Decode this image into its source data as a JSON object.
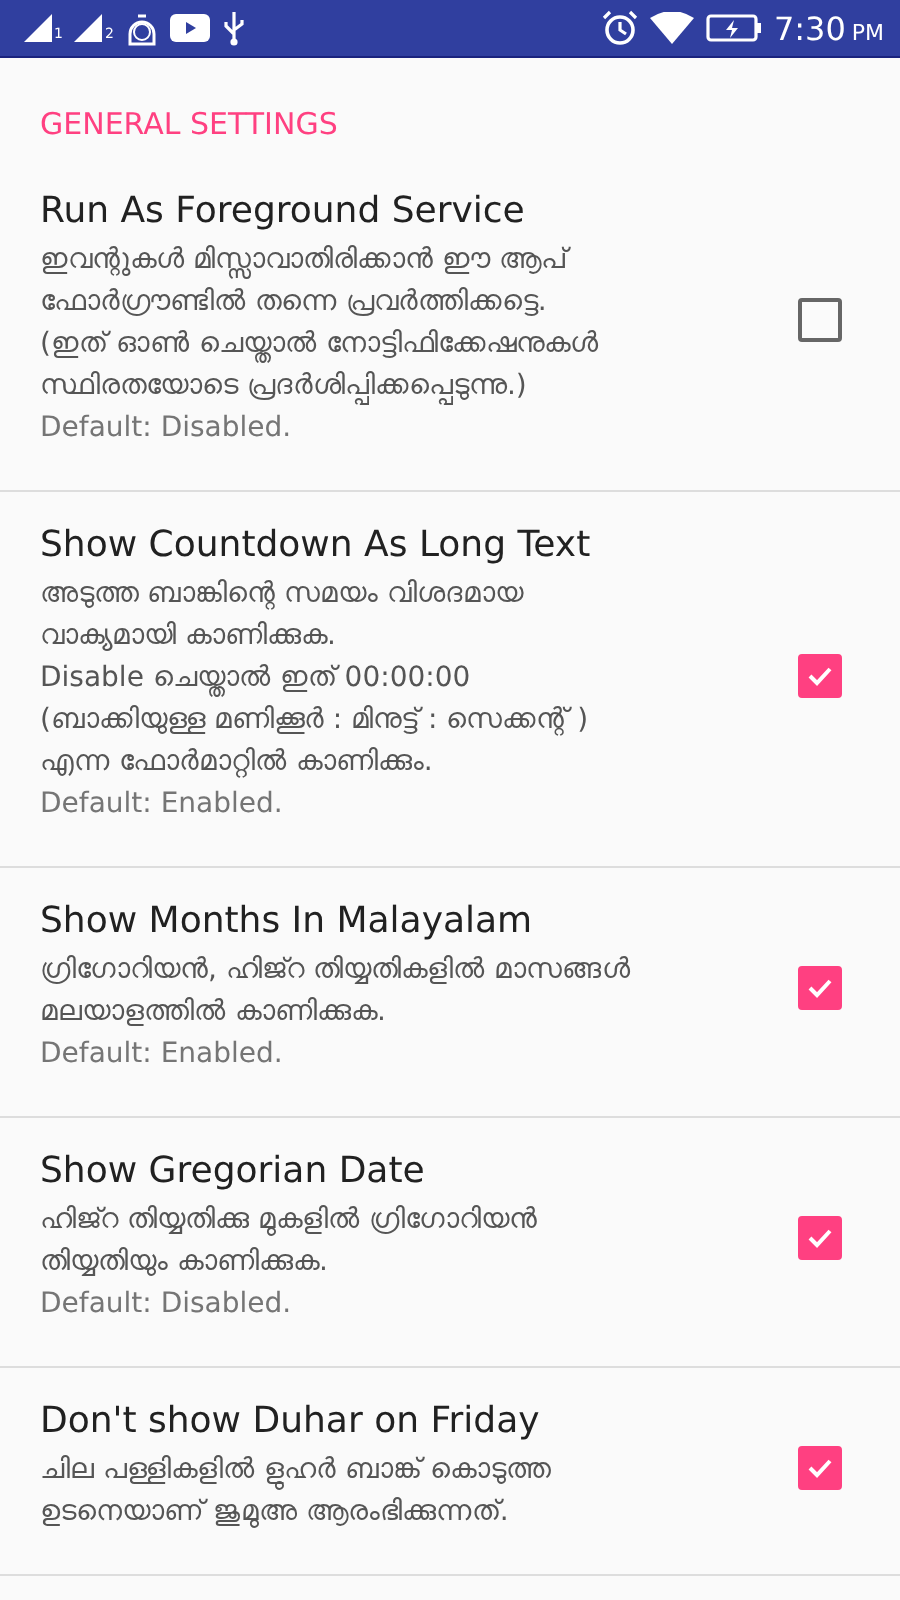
{
  "status_bar": {
    "sim_labels": [
      "1",
      "2"
    ],
    "time": "7:30",
    "meridiem": "PM"
  },
  "section": {
    "title": "GENERAL SETTINGS"
  },
  "settings": [
    {
      "title": "Run As Foreground Service",
      "summary": "ഇവന്റുകൾ മിസ്സാവാതിരിക്കാൻ ഈ ആപ്\nഫോർഗ്രൗണ്ടിൽ തന്നെ പ്രവർത്തിക്കട്ടെ.\n(ഇത് ഓൺ ചെയ്താൽ നോട്ടിഫിക്കേഷനുകൾ\nസ്ഥിരതയോടെ പ്രദർശിപ്പിക്കപ്പെടുന്നു.)",
      "default": "Default: Disabled.",
      "checked": false
    },
    {
      "title": "Show Countdown As Long Text",
      "summary": "അടുത്ത ബാങ്കിന്റെ സമയം വിശദമായ\nവാക്യമായി കാണിക്കുക.\nDisable ചെയ്താൽ ഇത് 00:00:00\n(ബാക്കിയുള്ള മണിക്കൂർ : മിനുട്ട് : സെക്കന്റ് )\nഎന്ന ഫോർമാറ്റിൽ കാണിക്കും.",
      "default": "Default: Enabled.",
      "checked": true
    },
    {
      "title": "Show Months In Malayalam",
      "summary": "ഗ്രിഗോറിയൻ, ഹിജ്റ തിയ്യതികളിൽ മാസങ്ങൾ\nമലയാളത്തിൽ കാണിക്കുക.",
      "default": "Default: Enabled.",
      "checked": true
    },
    {
      "title": "Show Gregorian Date",
      "summary": "ഹിജ്റ തിയ്യതിക്കു മുകളിൽ ഗ്രിഗോറിയൻ\nതിയ്യതിയും കാണിക്കുക.",
      "default": "Default: Disabled.",
      "checked": true
    },
    {
      "title": "Don't show Duhar on Friday",
      "summary": "ചില പള്ളികളിൽ ളുഹർ ബാങ്ക് കൊടുത്ത\nഉടനെയാണ് ജുമുഅ ആരംഭിക്കുന്നത്.",
      "checked": true
    }
  ]
}
